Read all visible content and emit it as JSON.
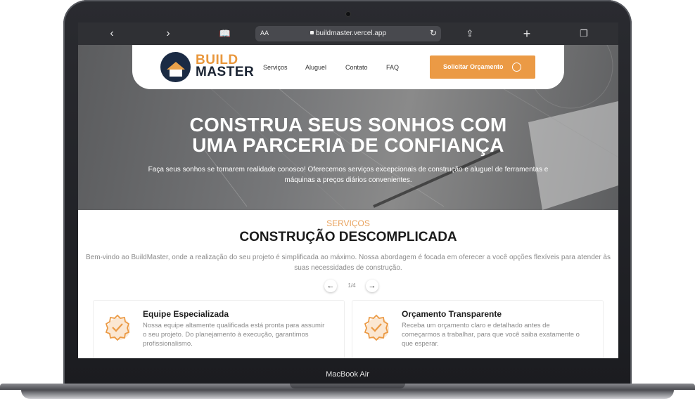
{
  "browser": {
    "reader_label": "AA",
    "url": "buildmaster.vercel.app"
  },
  "nav": {
    "logo_line1": "BUILD",
    "logo_line2": "MASTER",
    "links": [
      "Serviços",
      "Aluguel",
      "Contato",
      "FAQ"
    ],
    "cta_label": "Solicitar Orçamento"
  },
  "hero": {
    "title_line1": "CONSTRUA SEUS SONHOS COM",
    "title_line2": "UMA PARCERIA DE CONFIANÇA",
    "subtitle": "Faça seus sonhos se tornarem realidade conosco! Oferecemos serviços excepcionais de construção e aluguel de ferramentas e máquinas a preços diários convenientes."
  },
  "services": {
    "kicker": "SERVIÇOS",
    "title": "CONSTRUÇÃO DESCOMPLICADA",
    "intro": "Bem-vindo ao BuildMaster, onde a realização do seu projeto é simplificada ao máximo. Nossa abordagem é focada em oferecer a você opções flexíveis para atender às suas necessidades de construção.",
    "pager": "1/4",
    "cards": [
      {
        "title": "Equipe Especializada",
        "text": "Nossa equipe altamente qualificada está pronta para assumir o seu projeto. Do planejamento à execução, garantimos profissionalismo."
      },
      {
        "title": "Orçamento Transparente",
        "text": "Receba um orçamento claro e detalhado antes de começarmos a trabalhar, para que você saiba exatamente o que esperar."
      }
    ]
  },
  "device": {
    "model_label": "MacBook Air"
  },
  "colors": {
    "accent": "#eb9a45",
    "dark": "#1b2433"
  }
}
